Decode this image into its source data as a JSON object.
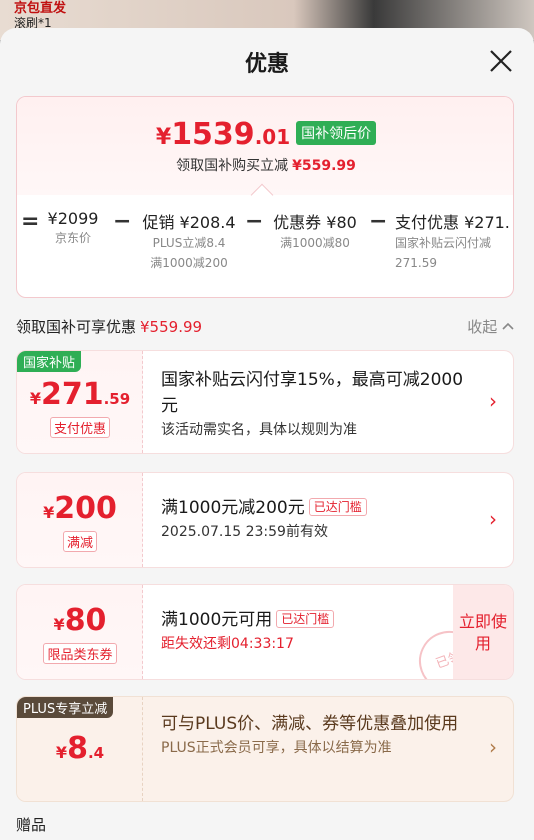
{
  "background": {
    "top_text": "京包直发",
    "top_text2": "滚刷*1"
  },
  "sheet": {
    "title": "优惠"
  },
  "summary": {
    "price_yen": "¥",
    "price_int": "1539",
    "price_dec": ".01",
    "price_tag": "国补领后价",
    "sub_text": "领取国补购买立减",
    "sub_amount": "¥559.99",
    "terms": [
      {
        "main": "¥2099",
        "sub1": "京东价",
        "sub2": ""
      },
      {
        "main": "促销 ¥208.4",
        "sub1": "PLUS立减8.4",
        "sub2": "满1000减200"
      },
      {
        "main": "优惠券 ¥80",
        "sub1": "满1000减80",
        "sub2": ""
      },
      {
        "main": "支付优惠 ¥271.",
        "sub1": "国家补贴云闪付减",
        "sub2": "271.59"
      }
    ],
    "ops": [
      "=",
      "−",
      "−",
      "−"
    ]
  },
  "section": {
    "label": "领取国补可享优惠",
    "amount": "¥559.99",
    "collapse": "收起"
  },
  "cards": [
    {
      "badge": "国家补贴",
      "yen": "¥",
      "int": "271",
      "dec": ".59",
      "tag": "支付优惠",
      "title": "国家补贴云闪付享15%，最高可减2000元",
      "sub": "该活动需实名，具体以规则为准"
    },
    {
      "yen": "¥",
      "int": "200",
      "dec": "",
      "tag": "满减",
      "title": "满1000元减200元",
      "pill": "已达门槛",
      "sub": "2025.07.15 23:59前有效"
    },
    {
      "yen": "¥",
      "int": "80",
      "dec": "",
      "tag": "限品类东券",
      "title": "满1000元可用",
      "pill": "已达门槛",
      "sub": "距失效还剩04:33:17",
      "button": "立即使用",
      "stamp": "已领"
    },
    {
      "badge": "PLUS专享立减",
      "yen": "¥",
      "int": "8",
      "dec": ".4",
      "title": "可与PLUS价、满减、券等优惠叠加使用",
      "sub": "PLUS正式会员可享，具体以结算为准"
    }
  ],
  "gift": {
    "label": "赠品"
  },
  "colors": {
    "accent": "#e4202e",
    "green": "#2fae55",
    "plus": "#5a4a3a"
  }
}
